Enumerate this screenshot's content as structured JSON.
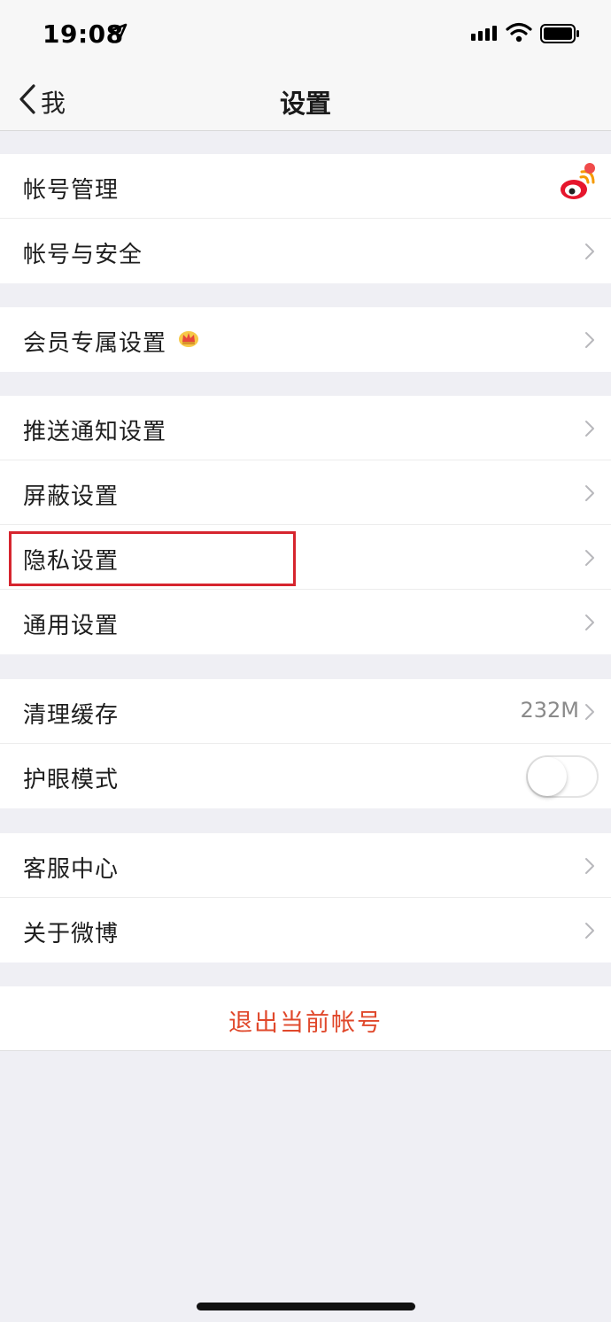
{
  "status_bar": {
    "time": "19:08",
    "icons": [
      "location-arrow-icon",
      "signal-bars-icon",
      "wifi-icon",
      "battery-icon"
    ]
  },
  "nav": {
    "back_label": "我",
    "title": "设置"
  },
  "groups": {
    "account": {
      "account_manage": "帐号管理",
      "account_security": "帐号与安全"
    },
    "vip": {
      "vip_settings": "会员专属设置"
    },
    "general": {
      "push": "推送通知设置",
      "block": "屏蔽设置",
      "privacy": "隐私设置",
      "common": "通用设置"
    },
    "storage": {
      "clear_cache": "清理缓存",
      "cache_size": "232M",
      "eye_mode": "护眼模式",
      "eye_mode_on": false
    },
    "about": {
      "service": "客服中心",
      "about_weibo": "关于微博"
    }
  },
  "logout": {
    "label": "退出当前帐号"
  },
  "colors": {
    "accent_red": "#e0482b",
    "highlight_red": "#d6252e",
    "background": "#efeff4"
  }
}
